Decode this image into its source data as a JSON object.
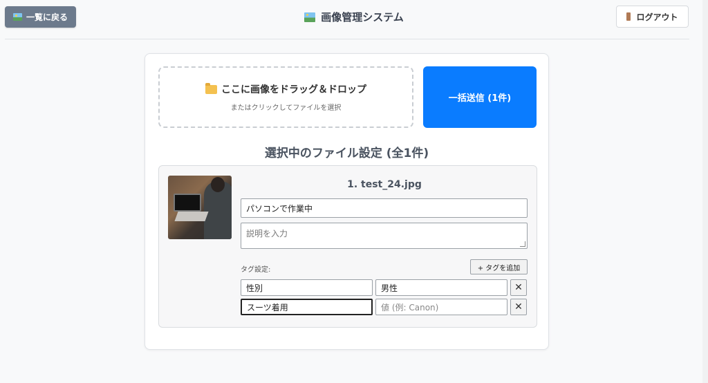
{
  "header": {
    "back_label": "一覧に戻る",
    "app_title": "画像管理システム",
    "logout_label": "ログアウト"
  },
  "upload": {
    "dropzone_title": "ここに画像をドラッグ＆ドロップ",
    "dropzone_subtitle": "またはクリックしてファイルを選択",
    "submit_label": "一括送信 (1件)"
  },
  "section_title": "選択中のファイル設定 (全1件)",
  "file": {
    "name": "1. test_24.jpg",
    "title_value": "パソコンで作業中",
    "description_placeholder": "説明を入力",
    "tags_label": "タグ設定:",
    "add_tag_label": "+ タグを追加",
    "tags": [
      {
        "key": "性別",
        "value": "男性",
        "value_placeholder": ""
      },
      {
        "key": "スーツ着用",
        "value": "",
        "value_placeholder": "値 (例: Canon)"
      }
    ],
    "delete_symbol": "✕"
  },
  "colors": {
    "submit_bg": "#0a7cff",
    "back_bg": "#6c7a8c"
  },
  "icons": {
    "back": "image-icon",
    "title": "image-icon",
    "logout": "door-icon",
    "dropzone": "folder-icon"
  }
}
